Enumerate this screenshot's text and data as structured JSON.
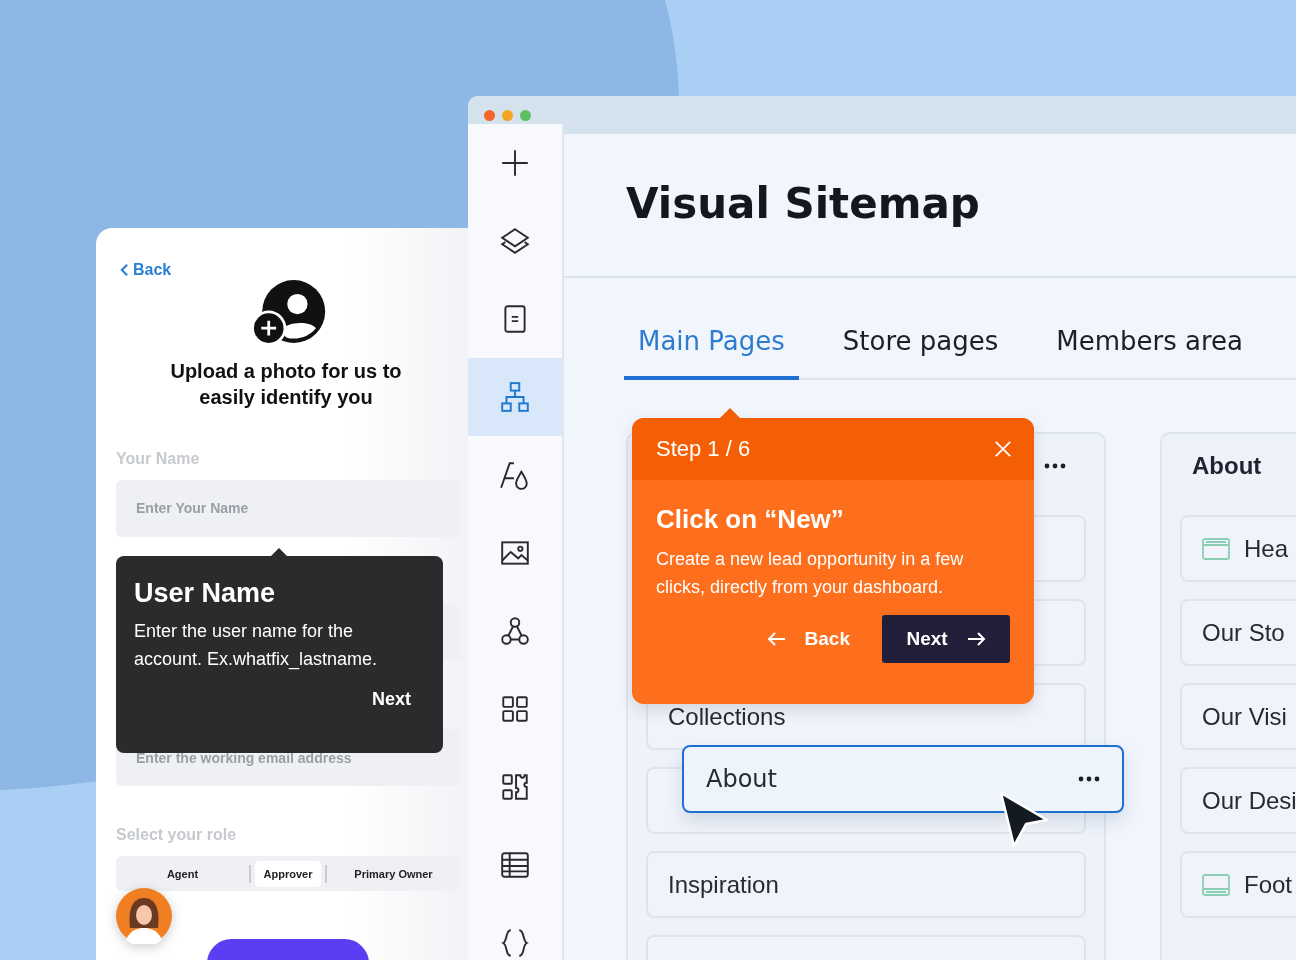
{
  "profile_form": {
    "back_link": "Back",
    "heading": "Upload a photo for us to easily identify you",
    "name_field": {
      "label": "Your Name",
      "placeholder": "Enter Your Name"
    },
    "email_field": {
      "placeholder": "Enter the working email address"
    },
    "role_label": "Select your role",
    "roles": [
      {
        "label": "Agent",
        "selected": false
      },
      {
        "label": "Approver",
        "selected": true
      },
      {
        "label": "Primary Owner",
        "selected": false
      }
    ],
    "tooltip": {
      "title": "User Name",
      "body": "Enter the user name for the account. Ex.whatfix_lastname.",
      "next": "Next"
    }
  },
  "editor": {
    "sidebar": [
      {
        "kind": "add",
        "selected": false
      },
      {
        "kind": "layers",
        "selected": false
      },
      {
        "kind": "page",
        "selected": false
      },
      {
        "kind": "sitemap",
        "selected": true
      },
      {
        "kind": "text-style",
        "selected": false
      },
      {
        "kind": "image",
        "selected": false
      },
      {
        "kind": "nodes",
        "selected": false
      },
      {
        "kind": "grid",
        "selected": false
      },
      {
        "kind": "apps",
        "selected": false
      },
      {
        "kind": "table",
        "selected": false
      },
      {
        "kind": "code",
        "selected": false
      }
    ],
    "title": "Visual Sitemap",
    "tabs": [
      {
        "label": "Main Pages",
        "selected": true
      },
      {
        "label": "Store pages",
        "selected": false
      },
      {
        "label": "Members area",
        "selected": false
      }
    ],
    "columns": [
      {
        "menu": true,
        "items": [
          {
            "kind": "page"
          },
          {
            "kind": "page"
          },
          {
            "kind": "page",
            "label": "Collections"
          },
          {
            "kind": "page"
          },
          {
            "kind": "page",
            "label": "Inspiration"
          },
          {
            "kind": "page"
          }
        ]
      },
      {
        "title": "About",
        "items": [
          {
            "kind": "header",
            "label": "Hea"
          },
          {
            "kind": "page",
            "label": "Our Sto"
          },
          {
            "kind": "page",
            "label": "Our Visi"
          },
          {
            "kind": "page",
            "label": "Our Desi"
          },
          {
            "kind": "footer",
            "label": "Foot"
          }
        ]
      }
    ],
    "dragged_item": {
      "label": "About"
    },
    "tour": {
      "step": "Step 1 / 6",
      "title": "Click on “New”",
      "body": "Create a new lead opportunity in a few clicks, directly from your dashboard.",
      "back": "Back",
      "next": "Next"
    }
  }
}
